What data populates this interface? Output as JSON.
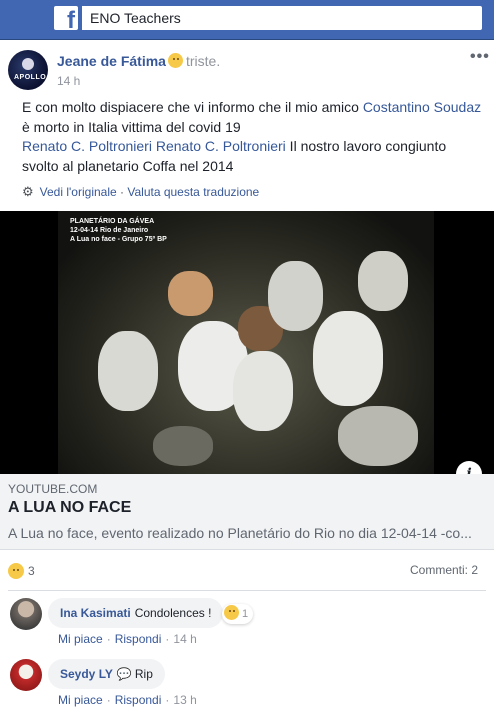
{
  "topbar": {
    "logo_icon": "facebook-logo-icon",
    "search_value": "ENO Teachers"
  },
  "post": {
    "author": "Jeane de Fátima",
    "feeling": "triste.",
    "feeling_icon": "sad-face-icon",
    "time": "14 h",
    "text": {
      "l1_pre": "E con molto dispiacere che vi informo che il mio amico ",
      "l1_link": "Costantino Soudaz",
      "l2": "è morto in Italia vittima del covid 19",
      "l3_link1": "Renato C. Poltronieri",
      "l3_link2": "Renato C. Poltronieri",
      "l3_post": " Il nostro lavoro congiunto",
      "l4": "svolto al planetario Coffa nel 2014"
    },
    "translate": {
      "see_original": "Vedi l'originale",
      "separator": "·",
      "rate": "Valuta questa traduzione"
    },
    "photo_caption": {
      "l1": "PLANETÁRIO DA GÁVEA",
      "l2": "12-04-14  Rio de Janeiro",
      "l3": "A Lua no face - Grupo 75º BP"
    },
    "avatar_text": "APOLLO"
  },
  "link_preview": {
    "domain": "YOUTUBE.COM",
    "title": "A LUA NO FACE",
    "description": "A Lua no face, evento realizado no Planetário do Rio no dia 12-04-14 -co..."
  },
  "stats": {
    "reactions_count": "3",
    "comments_label": "Commenti: 2"
  },
  "comments": [
    {
      "name": "Ina Kasimati",
      "text": "Condolences !",
      "reaction_count": "1",
      "like": "Mi piace",
      "reply": "Rispondi",
      "time": "14 h"
    },
    {
      "name": "Seydy LY",
      "text": "Rip",
      "like": "Mi piace",
      "reply": "Rispondi",
      "time": "13 h"
    }
  ],
  "colors": {
    "brand": "#4267b2",
    "link": "#385898",
    "text": "#1d2129",
    "muted": "#90949c"
  }
}
